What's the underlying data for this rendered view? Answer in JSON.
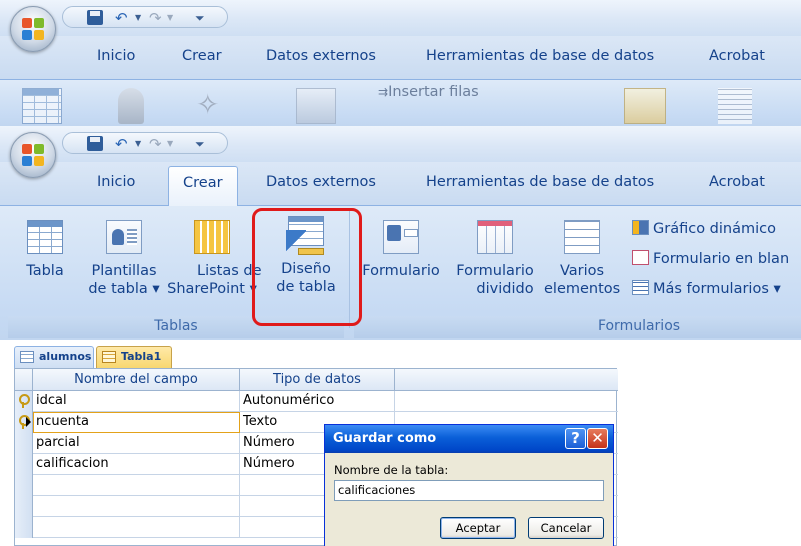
{
  "ribbon": {
    "tabs": [
      "Inicio",
      "Crear",
      "Datos externos",
      "Herramientas de base de datos",
      "Acrobat"
    ],
    "active_tab": "Crear",
    "background_insert_rows_label": "Insertar filas"
  },
  "groups": {
    "tables": {
      "label": "Tablas",
      "buttons": [
        {
          "line1": "Tabla",
          "line2": ""
        },
        {
          "line1": "Plantillas",
          "line2": "de tabla ▾"
        },
        {
          "line1": "Listas de",
          "line2": "SharePoint ▾"
        },
        {
          "line1": "Diseño",
          "line2": "de tabla"
        }
      ]
    },
    "forms": {
      "label": "Formularios",
      "buttons": [
        {
          "line1": "Formulario",
          "line2": ""
        },
        {
          "line1": "Formulario",
          "line2": "dividido"
        },
        {
          "line1": "Varios",
          "line2": "elementos"
        }
      ],
      "small": [
        "Gráfico dinámico",
        "Formulario en blan",
        "Más formularios ▾"
      ]
    }
  },
  "document_tabs": [
    "alumnos",
    "Tabla1"
  ],
  "design_grid": {
    "headers": [
      "Nombre del campo",
      "Tipo de datos"
    ],
    "rows": [
      {
        "field": "idcal",
        "type": "Autonumérico"
      },
      {
        "field": "ncuenta",
        "type": "Texto"
      },
      {
        "field": "parcial",
        "type": "Número"
      },
      {
        "field": "calificacion",
        "type": "Número"
      }
    ]
  },
  "dialog": {
    "title": "Guardar como",
    "help": "?",
    "close": "✕",
    "label": "Nombre de la tabla:",
    "value": "calificaciones",
    "ok": "Aceptar",
    "cancel": "Cancelar"
  },
  "colors": {
    "highlight": "#e01a1a",
    "titlebar_blue": "#0a5fd8"
  }
}
